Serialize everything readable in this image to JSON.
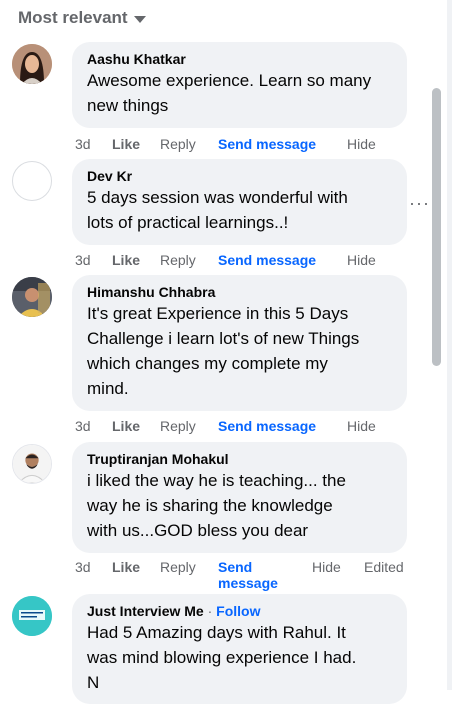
{
  "sort": {
    "label": "Most relevant"
  },
  "comments": [
    {
      "name": "Aashu Khatkar",
      "lines": [
        "Awesome experience. Learn so many",
        "new things"
      ],
      "time": "3d",
      "like": "Like",
      "reply": "Reply",
      "send": "Send message",
      "hide": "Hide"
    },
    {
      "name": "Dev Kr",
      "lines": [
        "5 days session was wonderful with",
        "lots of practical learnings..!"
      ],
      "time": "3d",
      "like": "Like",
      "reply": "Reply",
      "send": "Send message",
      "hide": "Hide"
    },
    {
      "name": "Himanshu Chhabra",
      "lines": [
        "It's great Experience in this 5 Days",
        "Challenge i learn lot's of new Things",
        "which changes my complete my",
        "mind."
      ],
      "time": "3d",
      "like": "Like",
      "reply": "Reply",
      "send": "Send message",
      "hide": "Hide"
    },
    {
      "name": "Truptiranjan Mohakul",
      "lines": [
        "i liked the way he is teaching... the",
        "way he is sharing the knowledge",
        "with us...GOD bless you dear"
      ],
      "time": "3d",
      "like": "Like",
      "reply": "Reply",
      "send_line1": "Send",
      "send_line2": "message",
      "hide": "Hide",
      "edited": "Edited"
    },
    {
      "name": "Just Interview Me",
      "follow": "Follow",
      "separator": "·",
      "lines": [
        "Had 5 Amazing days with Rahul. It",
        "was mind blowing experience I had.",
        "N"
      ],
      "avatar_text": "JustInterview Me"
    }
  ],
  "more_options": "···",
  "colors": {
    "accent": "#0866ff",
    "bubble": "#f0f2f5",
    "muted": "#65676b"
  }
}
